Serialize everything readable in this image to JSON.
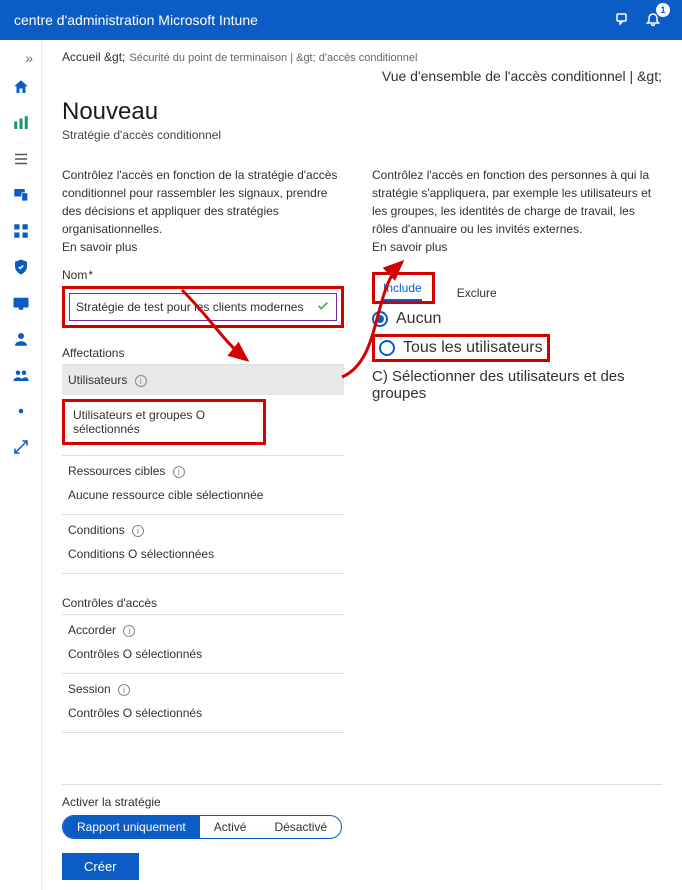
{
  "topbar": {
    "title": "centre d'administration Microsoft Intune",
    "notification_count": "1"
  },
  "crumbs": {
    "home": "Accueil &gt;",
    "mid": "Sécurité du point de terminaison | &gt; d'accès conditionnel",
    "right": "Vue d'ensemble de l'accès conditionnel | &gt;"
  },
  "page": {
    "title": "Nouveau",
    "subtitle": "Stratégie d'accès conditionnel"
  },
  "left": {
    "desc": "Contrôlez l'accès en fonction de la stratégie d'accès conditionnel pour rassembler les signaux, prendre des décisions et appliquer des stratégies organisationnelles.",
    "learn": "En savoir plus",
    "name_label": "Nom",
    "name_value": "Stratégie de test pour les clients modernes",
    "affectations": "Affectations",
    "users": "Utilisateurs",
    "users_selected": "Utilisateurs et groupes O sélectionnés",
    "resources_head": "Ressources cibles",
    "resources_value": "Aucune ressource cible sélectionnée",
    "conditions_head": "Conditions",
    "conditions_value": "Conditions O sélectionnées",
    "controls_head": "Contrôles d'accès",
    "grant_head": "Accorder",
    "grant_value": "Contrôles O sélectionnés",
    "session_head": "Session",
    "session_value": "Contrôles O sélectionnés"
  },
  "right": {
    "desc": "Contrôlez l'accès en fonction des personnes à qui la stratégie s'appliquera, par exemple les utilisateurs et les groupes, les identités de charge de travail, les rôles d'annuaire ou les invités externes.",
    "learn": "En savoir plus",
    "tab_include": "Include",
    "tab_exclude": "Exclure",
    "opt_none": "Aucun",
    "opt_all": "Tous les utilisateurs",
    "opt_c": "C) Sélectionner des utilisateurs et des groupes"
  },
  "bottom": {
    "activate": "Activer la stratégie",
    "report_only": "Rapport uniquement",
    "active": "Activé",
    "disabled": "Désactivé",
    "create": "Créer"
  }
}
